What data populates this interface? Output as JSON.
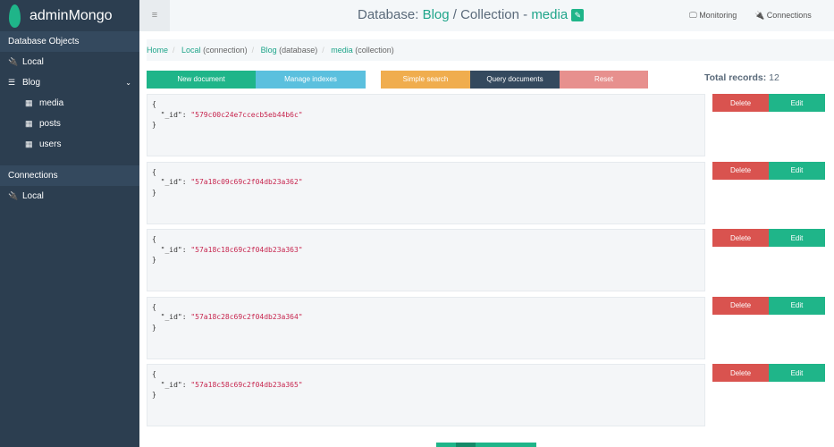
{
  "app": {
    "name": "adminMongo"
  },
  "sidebar": {
    "section1": "Database Objects",
    "local": "Local",
    "db": "Blog",
    "collections": [
      "media",
      "posts",
      "users"
    ],
    "section2": "Connections",
    "conn": "Local"
  },
  "header": {
    "menu": "≡",
    "prefix": "Database:",
    "db": "Blog",
    "mid": "/ Collection -",
    "collection": "media",
    "monitoring": "Monitoring",
    "connections": "Connections"
  },
  "breadcrumb": {
    "home": "Home",
    "local": "Local",
    "local_t": "(connection)",
    "db": "Blog",
    "db_t": "(database)",
    "coll": "media",
    "coll_t": "(collection)"
  },
  "toolbar": {
    "new": "New document",
    "indexes": "Manage indexes",
    "simple": "Simple search",
    "query": "Query documents",
    "reset": "Reset",
    "total_label": "Total records:",
    "total": "12"
  },
  "documents": [
    {
      "id": "\"579c00c24e7ccecb5eb44b6c\""
    },
    {
      "id": "\"57a18c09c69c2f04db23a362\""
    },
    {
      "id": "\"57a18c18c69c2f04db23a363\""
    },
    {
      "id": "\"57a18c28c69c2f04db23a364\""
    },
    {
      "id": "\"57a18c58c69c2f04db23a365\""
    }
  ],
  "doc_labels": {
    "open": "{",
    "key": "  \"_id\": ",
    "close": "}",
    "delete": "Delete",
    "edit": "Edit"
  }
}
